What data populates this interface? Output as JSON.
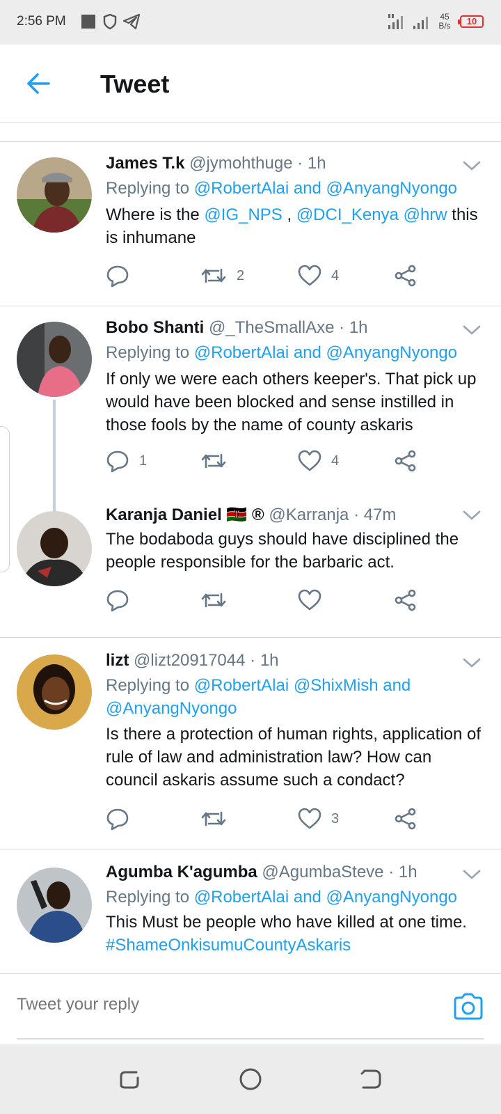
{
  "status_bar": {
    "time": "2:56 PM",
    "net_speed_value": "45",
    "net_speed_unit": "B/s",
    "battery": "10",
    "icons": [
      "notification-square-icon",
      "shield-icon",
      "telegram-icon",
      "signal-icon",
      "signal-icon"
    ]
  },
  "header": {
    "title": "Tweet"
  },
  "tweets": [
    {
      "name": "James T.k",
      "handle": "@jymohthuge",
      "time": "· 1h",
      "reply_prefix": "Replying to",
      "reply_mentions": "@RobertAlai and @AnyangNyongo",
      "text_parts": [
        "Where is the ",
        "@IG_NPS",
        " , ",
        "@DCI_Kenya",
        " ",
        "@hrw",
        " this is inhumane"
      ],
      "retweets": "2",
      "likes": "4",
      "replies": ""
    },
    {
      "name": "Bobo Shanti",
      "handle": "@_TheSmallAxe",
      "time": "· 1h",
      "reply_prefix": "Replying to",
      "reply_mentions": "@RobertAlai and @AnyangNyongo",
      "text": "If only we were each others keeper's. That pick up would have been blocked and sense instilled in those fools by the name of county askaris",
      "replies": "1",
      "retweets": "",
      "likes": "4"
    },
    {
      "name": "Karanja Daniel",
      "flag_badge": "🇰🇪",
      "registered_badge": "®",
      "handle": "@Karranja",
      "time": "· 47m",
      "text": "The bodaboda guys should have disciplined the people responsible for the barbaric act.",
      "replies": "",
      "retweets": "",
      "likes": ""
    },
    {
      "name": "lizt",
      "handle": "@lizt20917044",
      "time": "· 1h",
      "reply_prefix": "Replying to",
      "reply_mentions": "@RobertAlai @ShixMish and @AnyangNyongo",
      "text": "Is there a protection of human rights, application of rule of law and  administration law? How can council askaris assume such a condact?",
      "replies": "",
      "retweets": "",
      "likes": "3"
    },
    {
      "name": "Agumba K'agumba",
      "handle": "@AgumbaSteve",
      "time": "· 1h",
      "reply_prefix": "Replying to",
      "reply_mentions": "@RobertAlai and @AnyangNyongo",
      "text": "This Must be people who have killed at one time.",
      "hashtag": "#ShameOnkisumuCountyAskaris"
    }
  ],
  "reply_bar": {
    "placeholder": "Tweet your reply"
  },
  "colors": {
    "accent": "#1da1f2",
    "secondary_text": "#657786",
    "divider": "#d6dbe0",
    "battery_low": "#e23030"
  }
}
